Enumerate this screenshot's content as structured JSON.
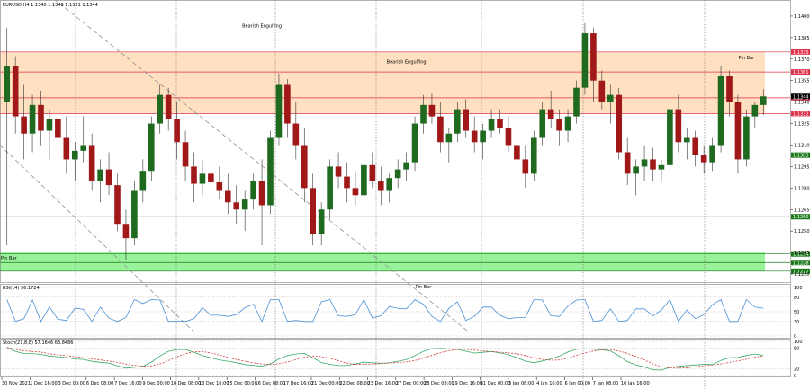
{
  "chart_data": [
    {
      "type": "candlestick",
      "header": "EURUSD,H4  1.1340 1.1349 1.1331 1.1344",
      "ylim": [
        1.1215,
        1.141
      ],
      "price_ticks": [
        "1.1400",
        "1.1385",
        "1.1370",
        "1.1355",
        "1.1340",
        "1.1325",
        "1.1310",
        "1.1295",
        "1.1280",
        "1.1265",
        "1.1250",
        "1.1235",
        "1.1220"
      ],
      "price_tick_values": [
        1.14,
        1.1385,
        1.137,
        1.1355,
        1.134,
        1.1325,
        1.131,
        1.1295,
        1.128,
        1.1265,
        1.125,
        1.1235,
        1.122
      ],
      "zones": [
        {
          "name": "resistance",
          "from": 1.1332,
          "to": 1.1375,
          "color": "#ffe0c0"
        },
        {
          "name": "support",
          "from": 1.1222,
          "to": 1.1235,
          "color": "#99f299"
        }
      ],
      "levels": [
        {
          "price": 1.1375,
          "label": "1.1375",
          "color": "#e0304a"
        },
        {
          "price": 1.1361,
          "label": "1.1361",
          "color": "#e0304a"
        },
        {
          "price": 1.1343,
          "label": "1.1343",
          "color": "#e0304a"
        },
        {
          "price": 1.1332,
          "label": "1.1332",
          "color": "#e0304a"
        },
        {
          "price": 1.1303,
          "label": "1.1303",
          "color": "#1a7a1a"
        },
        {
          "price": 1.126,
          "label": "1.1260",
          "color": "#1a7a1a"
        },
        {
          "price": 1.1234,
          "label": "1.1234",
          "color": "#1a7a1a"
        },
        {
          "price": 1.1228,
          "label": "1.1228",
          "color": "#1a7a1a"
        },
        {
          "price": 1.1222,
          "label": "1.1222",
          "color": "#1a7a1a"
        }
      ],
      "current_price": "1.1344",
      "annotations": [
        {
          "text": "Bearish Engulfing",
          "x": 5,
          "price": 1.1392
        },
        {
          "text": "Pin Bar",
          "x": 14.5,
          "price": 1.137
        },
        {
          "text": "Bearish Engulfing",
          "x": 7.8,
          "price": 1.1367
        },
        {
          "text": "Pin Bar",
          "x": 8.2,
          "price": 1.121
        },
        {
          "text": "Pin Bar",
          "x": 0.1,
          "price": 1.123
        }
      ],
      "x_labels": [
        "30 Nov 2021",
        "1 Dec 16:00",
        "3 Dec 00:00",
        "6 Dec 08:00",
        "7 Dec 16:00",
        "9 Dec 00:00",
        "10 Dec 08:00",
        "13 Dec 16:00",
        "15 Dec 00:00",
        "16 Dec 08:00",
        "17 Dec 16:00",
        "21 Dec 00:00",
        "22 Dec 08:00",
        "23 Dec 16:00",
        "27 Dec 00:00",
        "28 Dec 08:00",
        "29 Dec 16:00",
        "31 Dec 00:00",
        "3 Jan 08:00",
        "4 Jan 16:00",
        "6 Jan 00:00",
        "7 Jan 08:00",
        "10 Jan 16:00"
      ],
      "candles": [
        [
          1.134,
          1.1392,
          1.124,
          1.1365
        ],
        [
          1.1365,
          1.1372,
          1.1318,
          1.133
        ],
        [
          1.133,
          1.1352,
          1.13,
          1.1318
        ],
        [
          1.1318,
          1.1345,
          1.1305,
          1.1338
        ],
        [
          1.1338,
          1.1348,
          1.131,
          1.132
        ],
        [
          1.132,
          1.1335,
          1.13,
          1.1328
        ],
        [
          1.1328,
          1.134,
          1.1305,
          1.1315
        ],
        [
          1.1315,
          1.133,
          1.129,
          1.13
        ],
        [
          1.13,
          1.1312,
          1.1285,
          1.1306
        ],
        [
          1.1306,
          1.133,
          1.1298,
          1.131
        ],
        [
          1.131,
          1.1318,
          1.1278,
          1.1285
        ],
        [
          1.1285,
          1.13,
          1.127,
          1.1293
        ],
        [
          1.1293,
          1.1305,
          1.1275,
          1.1282
        ],
        [
          1.1282,
          1.129,
          1.125,
          1.1255
        ],
        [
          1.1255,
          1.1265,
          1.123,
          1.1245
        ],
        [
          1.1245,
          1.1285,
          1.124,
          1.1278
        ],
        [
          1.1278,
          1.13,
          1.127,
          1.1292
        ],
        [
          1.1292,
          1.133,
          1.1285,
          1.1325
        ],
        [
          1.1325,
          1.1352,
          1.1318,
          1.1345
        ],
        [
          1.1345,
          1.135,
          1.132,
          1.1328
        ],
        [
          1.1328,
          1.134,
          1.13,
          1.1312
        ],
        [
          1.1312,
          1.132,
          1.1285,
          1.1295
        ],
        [
          1.1295,
          1.1305,
          1.127,
          1.1283
        ],
        [
          1.1283,
          1.13,
          1.1275,
          1.129
        ],
        [
          1.129,
          1.1305,
          1.128,
          1.1284
        ],
        [
          1.1284,
          1.1295,
          1.1272,
          1.1278
        ],
        [
          1.1278,
          1.129,
          1.1262,
          1.127
        ],
        [
          1.127,
          1.1282,
          1.1255,
          1.1265
        ],
        [
          1.1265,
          1.1278,
          1.125,
          1.1272
        ],
        [
          1.1272,
          1.129,
          1.1265,
          1.1285
        ],
        [
          1.1285,
          1.13,
          1.124,
          1.1268
        ],
        [
          1.1268,
          1.132,
          1.1262,
          1.1315
        ],
        [
          1.1315,
          1.136,
          1.131,
          1.1352
        ],
        [
          1.1352,
          1.1356,
          1.1315,
          1.1325
        ],
        [
          1.1325,
          1.134,
          1.13,
          1.131
        ],
        [
          1.131,
          1.1322,
          1.127,
          1.128
        ],
        [
          1.128,
          1.129,
          1.124,
          1.1248
        ],
        [
          1.1248,
          1.127,
          1.124,
          1.1265
        ],
        [
          1.1265,
          1.13,
          1.1258,
          1.1295
        ],
        [
          1.1295,
          1.1305,
          1.128,
          1.1288
        ],
        [
          1.1288,
          1.1298,
          1.127,
          1.128
        ],
        [
          1.128,
          1.1292,
          1.1268,
          1.1275
        ],
        [
          1.1275,
          1.13,
          1.127,
          1.1296
        ],
        [
          1.1296,
          1.1305,
          1.128,
          1.1285
        ],
        [
          1.1285,
          1.1295,
          1.1268,
          1.1278
        ],
        [
          1.1278,
          1.129,
          1.127,
          1.1287
        ],
        [
          1.1287,
          1.13,
          1.128,
          1.1293
        ],
        [
          1.1293,
          1.1305,
          1.1285,
          1.1298
        ],
        [
          1.1298,
          1.133,
          1.1292,
          1.1325
        ],
        [
          1.1325,
          1.1345,
          1.1318,
          1.1338
        ],
        [
          1.1338,
          1.1346,
          1.1325,
          1.133
        ],
        [
          1.133,
          1.134,
          1.1305,
          1.1312
        ],
        [
          1.1312,
          1.1322,
          1.1298,
          1.1318
        ],
        [
          1.1318,
          1.134,
          1.1312,
          1.1335
        ],
        [
          1.1335,
          1.1342,
          1.1315,
          1.132
        ],
        [
          1.132,
          1.133,
          1.1305,
          1.1312
        ],
        [
          1.1312,
          1.1325,
          1.13,
          1.132
        ],
        [
          1.132,
          1.1335,
          1.1315,
          1.1328
        ],
        [
          1.1328,
          1.1335,
          1.1318,
          1.1322
        ],
        [
          1.1322,
          1.133,
          1.1305,
          1.131
        ],
        [
          1.131,
          1.1318,
          1.1295,
          1.13
        ],
        [
          1.13,
          1.131,
          1.128,
          1.129
        ],
        [
          1.129,
          1.132,
          1.1285,
          1.1315
        ],
        [
          1.1315,
          1.134,
          1.131,
          1.1335
        ],
        [
          1.1335,
          1.1348,
          1.1322,
          1.1328
        ],
        [
          1.1328,
          1.1335,
          1.131,
          1.132
        ],
        [
          1.132,
          1.1335,
          1.1312,
          1.133
        ],
        [
          1.133,
          1.1355,
          1.1325,
          1.135
        ],
        [
          1.135,
          1.1395,
          1.1345,
          1.1388
        ],
        [
          1.1388,
          1.1392,
          1.134,
          1.1355
        ],
        [
          1.1355,
          1.1362,
          1.1335,
          1.134
        ],
        [
          1.134,
          1.1352,
          1.1325,
          1.1345
        ],
        [
          1.1345,
          1.135,
          1.13,
          1.1305
        ],
        [
          1.1305,
          1.1315,
          1.1282,
          1.129
        ],
        [
          1.129,
          1.13,
          1.1275,
          1.1295
        ],
        [
          1.1295,
          1.131,
          1.1285,
          1.13
        ],
        [
          1.13,
          1.1308,
          1.1285,
          1.1293
        ],
        [
          1.1293,
          1.13,
          1.1285,
          1.1296
        ],
        [
          1.1296,
          1.134,
          1.129,
          1.1335
        ],
        [
          1.1335,
          1.1345,
          1.1305,
          1.1312
        ],
        [
          1.1312,
          1.1322,
          1.13,
          1.1315
        ],
        [
          1.1315,
          1.132,
          1.1295,
          1.1303
        ],
        [
          1.1303,
          1.131,
          1.129,
          1.1298
        ],
        [
          1.1298,
          1.1315,
          1.1292,
          1.131
        ],
        [
          1.131,
          1.1365,
          1.1305,
          1.1358
        ],
        [
          1.1358,
          1.1362,
          1.133,
          1.134
        ],
        [
          1.134,
          1.1345,
          1.129,
          1.13
        ],
        [
          1.13,
          1.1335,
          1.1295,
          1.133
        ],
        [
          1.133,
          1.134,
          1.1322,
          1.1338
        ],
        [
          1.1338,
          1.1349,
          1.1331,
          1.1344
        ]
      ]
    },
    {
      "type": "line",
      "header": "RSI(14) 56.1724",
      "ylim": [
        0,
        100
      ],
      "ticks": [
        "100",
        "80",
        "50",
        "30",
        "0"
      ],
      "tick_values": [
        100,
        80,
        50,
        30,
        0
      ],
      "color": "#4a8fd4"
    },
    {
      "type": "line",
      "header": "Stoch(21,8,8) 57.1646 63.8486",
      "ylim": [
        0,
        100
      ],
      "ticks": [
        "100",
        "80",
        "20",
        "0"
      ],
      "tick_values": [
        100,
        80,
        20,
        0
      ],
      "series": [
        {
          "name": "main",
          "color": "#3aaa6a"
        },
        {
          "name": "signal",
          "color": "#d04040"
        }
      ]
    }
  ]
}
